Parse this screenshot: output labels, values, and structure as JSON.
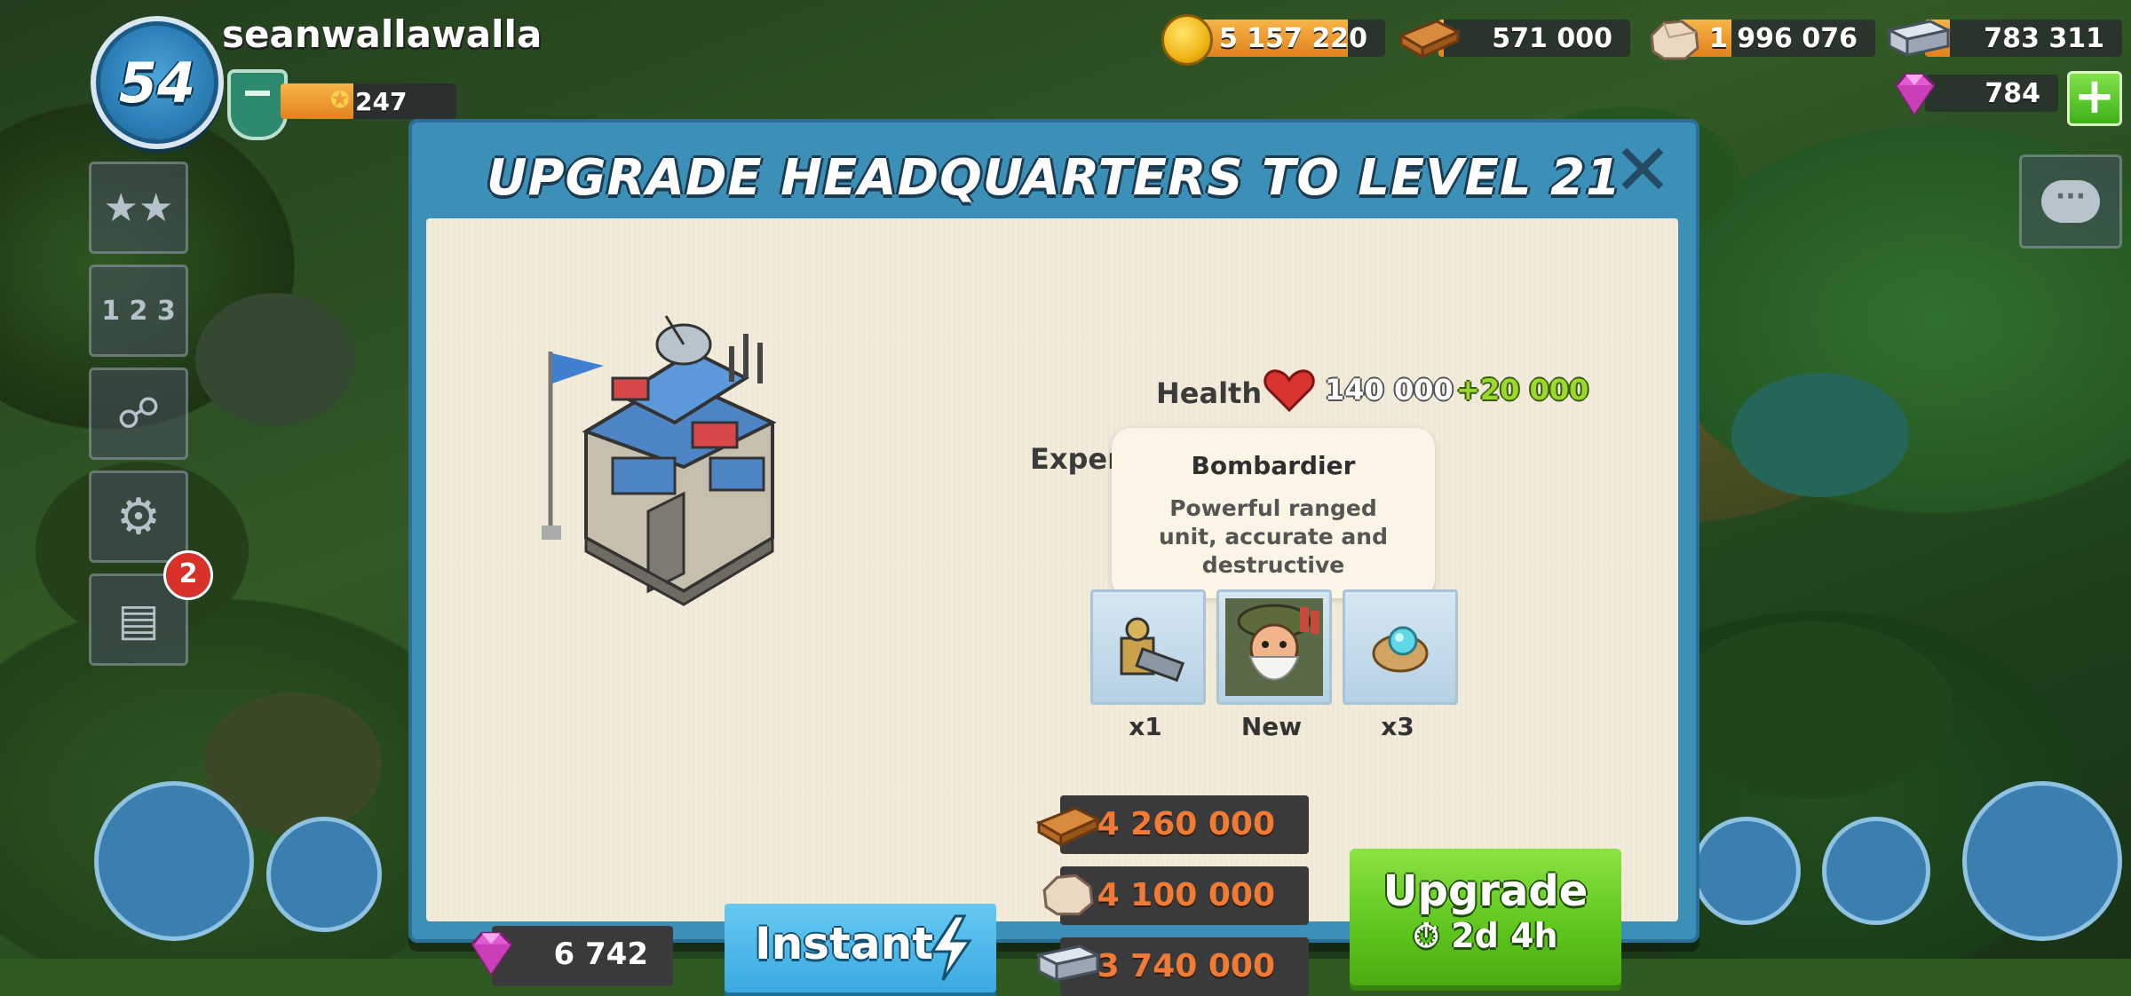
{
  "player": {
    "level": "54",
    "name": "seanwallawalla",
    "rank_value": "247"
  },
  "resources": {
    "gold": "5 157 220",
    "wood": "571 000",
    "stone": "1 996 076",
    "iron": "783 311",
    "diamonds": "784"
  },
  "sidebar": {
    "notification_count": "2"
  },
  "dialog": {
    "title": "UPGRADE HEADQUARTERS TO LEVEL 21",
    "stats": {
      "health_label": "Health",
      "health_value": "140 000",
      "health_bonus": "+20 000",
      "experience_label": "Experien"
    },
    "tooltip": {
      "title": "Bombardier",
      "description": "Powerful ranged unit, accurate and destructive"
    },
    "unlocks": [
      {
        "icon": "cannon-icon",
        "label": "x1"
      },
      {
        "icon": "bombardier-portrait",
        "label": "New"
      },
      {
        "icon": "gem-stone-icon",
        "label": "x3"
      }
    ],
    "costs": {
      "wood": "4 260 000",
      "stone": "4 100 000",
      "iron": "3 740 000"
    },
    "instant": {
      "gem_cost": "6 742",
      "label": "Instant"
    },
    "upgrade": {
      "label": "Upgrade",
      "time": "2d 4h"
    }
  },
  "colors": {
    "dialog_frame": "#3c8fb7",
    "panel": "#f2ebd9",
    "upgrade_green": "#5ec51d",
    "instant_blue": "#3aa9e0",
    "cost_orange": "#f07a36",
    "bonus_green": "#9bd82b"
  }
}
